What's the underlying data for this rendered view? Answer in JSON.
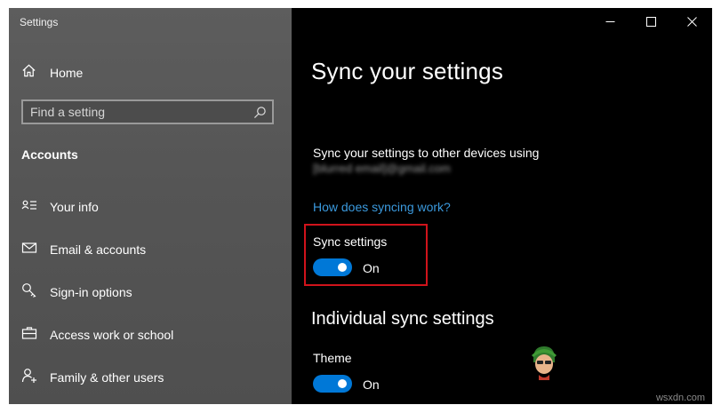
{
  "window": {
    "title": "Settings"
  },
  "sidebar": {
    "home_label": "Home",
    "search_placeholder": "Find a setting",
    "section_heading": "Accounts",
    "items": [
      {
        "label": "Your info",
        "icon": "person-card-icon"
      },
      {
        "label": "Email & accounts",
        "icon": "mail-icon"
      },
      {
        "label": "Sign-in options",
        "icon": "key-icon"
      },
      {
        "label": "Access work or school",
        "icon": "briefcase-icon"
      },
      {
        "label": "Family & other users",
        "icon": "person-add-icon"
      }
    ]
  },
  "main": {
    "title": "Sync your settings",
    "description": "Sync your settings to other devices using",
    "account_email": "[blurred email]@gmail.com",
    "help_link": "How does syncing work?",
    "sync_settings": {
      "label": "Sync settings",
      "state": "On",
      "enabled": true
    },
    "individual_heading": "Individual sync settings",
    "theme": {
      "label": "Theme",
      "state": "On",
      "enabled": true
    }
  },
  "watermark": {
    "text": "wsxdn.com"
  },
  "colors": {
    "accent": "#0078d7",
    "link": "#3b9ade",
    "sidebar_bg": "#575757",
    "content_bg": "#000000",
    "highlight_border": "#d0131b"
  }
}
